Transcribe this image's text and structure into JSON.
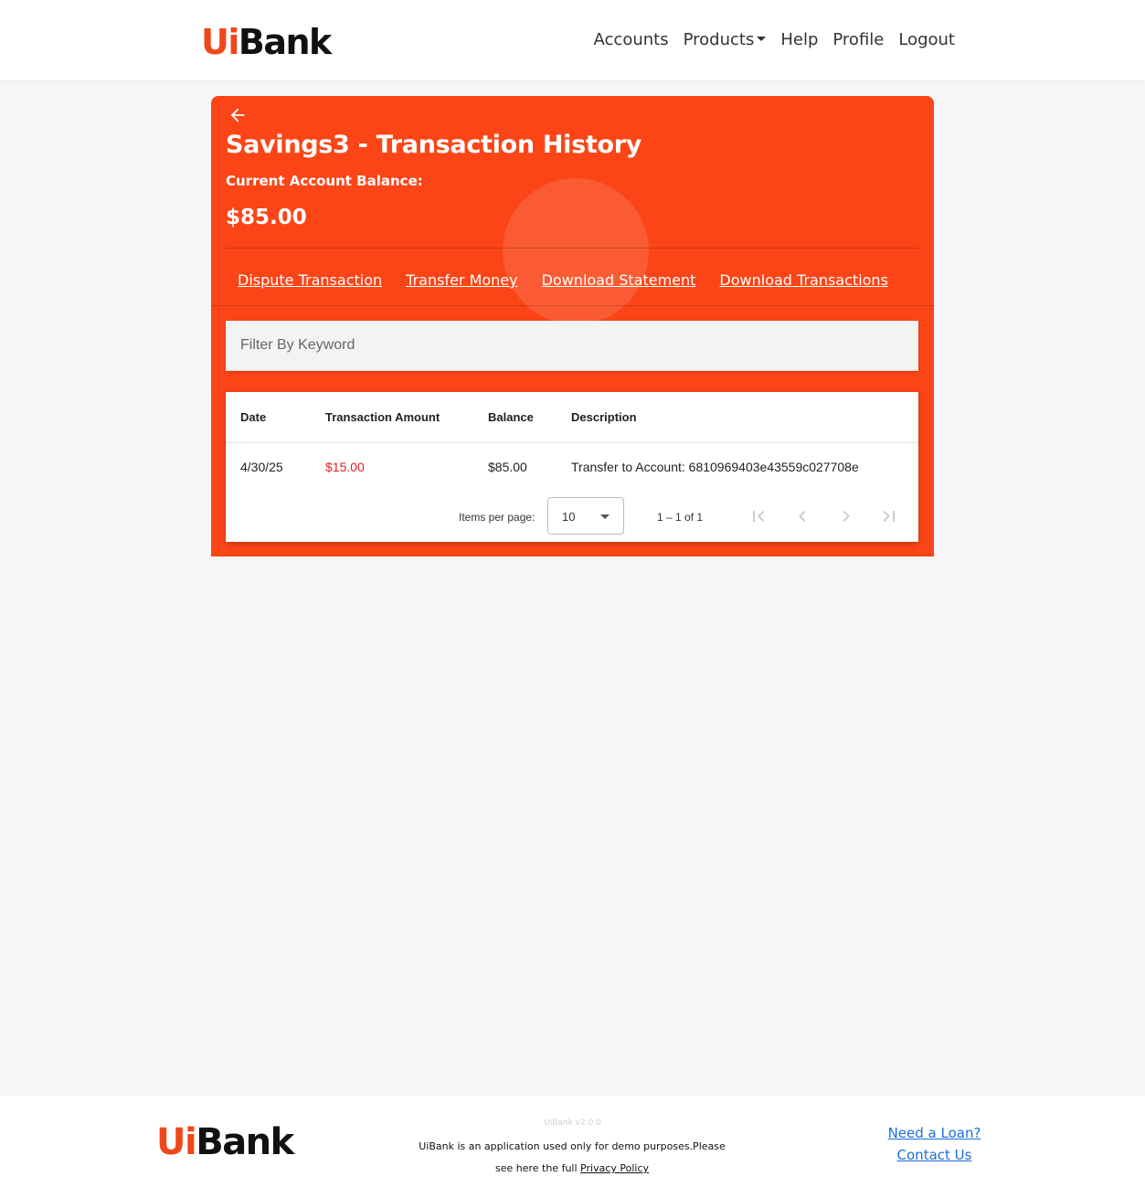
{
  "brand": {
    "logo_ui": "Ui",
    "logo_bank": "Bank"
  },
  "nav": {
    "items": [
      "Accounts",
      "Products",
      "Help",
      "Profile",
      "Logout"
    ]
  },
  "account": {
    "title": "Savings3 - Transaction History",
    "balance_label": "Current Account Balance:",
    "balance_value": "$85.00"
  },
  "actions": [
    "Dispute Transaction",
    "Transfer Money",
    "Download Statement",
    "Download Transactions"
  ],
  "filter": {
    "placeholder": "Filter By Keyword"
  },
  "table": {
    "headers": [
      "Date",
      "Transaction Amount",
      "Balance",
      "Description"
    ],
    "rows": [
      {
        "date": "4/30/25",
        "amount": "$15.00",
        "balance": "$85.00",
        "description": "Transfer to Account: 6810969403e43559c027708e"
      }
    ]
  },
  "paginator": {
    "items_per_page_label": "Items per page:",
    "items_per_page_value": "10",
    "range_label": "1 – 1 of 1"
  },
  "footer": {
    "version": "UiBank v2.0.0",
    "note_line1": "UiBank is an application used only for demo purposes.Please",
    "note_line2_prefix": "see here the full ",
    "privacy_link": "Privacy Policy",
    "loan_link": "Need a Loan?",
    "contact_link": "Contact Us"
  },
  "colors": {
    "brand_orange": "#fb4516",
    "negative_amount": "#e0201b",
    "link_blue": "#1a6ed8"
  },
  "icons": [
    "arrow-left-icon",
    "chevron-down-icon",
    "first-page-icon",
    "previous-page-icon",
    "next-page-icon",
    "last-page-icon"
  ]
}
